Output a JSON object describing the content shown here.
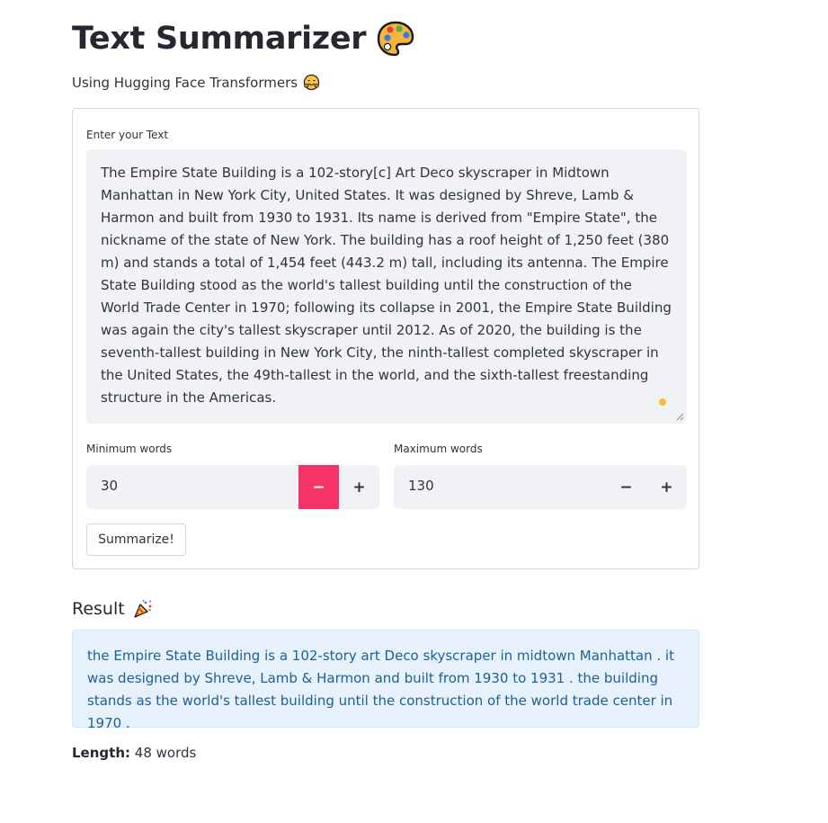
{
  "header": {
    "title": "Text Summarizer",
    "title_icon": "artist-palette-icon",
    "subtitle": "Using Hugging Face Transformers",
    "subtitle_icon": "hugging-face-icon"
  },
  "form": {
    "text_label": "Enter your Text",
    "text_value": "The Empire State Building is a 102-story[c] Art Deco skyscraper in Midtown Manhattan in New York City, United States. It was designed by Shreve, Lamb & Harmon and built from 1930 to 1931. Its name is derived from \"Empire State\", the nickname of the state of New York. The building has a roof height of 1,250 feet (380 m) and stands a total of 1,454 feet (443.2 m) tall, including its antenna. The Empire State Building stood as the world's tallest building until the construction of the World Trade Center in 1970; following its collapse in 2001, the Empire State Building was again the city's tallest skyscraper until 2012. As of 2020, the building is the seventh-tallest building in New York City, the ninth-tallest completed skyscraper in the United States, the 49th-tallest in the world, and the sixth-tallest freestanding structure in the Americas.",
    "min_words": {
      "label": "Minimum words",
      "value": "30",
      "minus": "−",
      "plus": "+"
    },
    "max_words": {
      "label": "Maximum words",
      "value": "130",
      "minus": "−",
      "plus": "+"
    },
    "submit_label": "Summarize!"
  },
  "result": {
    "heading": "Result",
    "heading_icon": "party-popper-icon",
    "text": "the Empire State Building is a 102-story art Deco skyscraper in midtown Manhattan . it was designed by Shreve, Lamb & Harmon and built from 1930 to 1931 . the building stands as the world's tallest building until the construction of the world trade center in 1970 .",
    "length_label": "Length:",
    "length_value": "48 words"
  },
  "colors": {
    "accent": "#f63366",
    "result_bg": "#e6f1fc",
    "result_text": "#1e6193",
    "input_bg": "#f0f2f6",
    "running_dot": "#fdbb3c"
  }
}
